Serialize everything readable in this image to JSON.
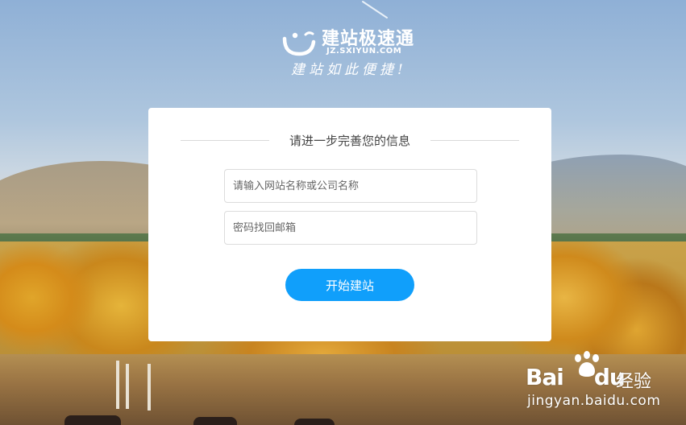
{
  "logo": {
    "name": "建站极速通",
    "domain": "JZ.SXIYUN.COM",
    "slogan": "建站如此便捷!"
  },
  "form": {
    "title": "请进一步完善您的信息",
    "site_name": {
      "placeholder": "请输入网站名称或公司名称",
      "value": ""
    },
    "email": {
      "placeholder": "密码找回邮箱",
      "value": ""
    },
    "submit_label": "开始建站"
  },
  "colors": {
    "accent": "#109ffb",
    "card_bg": "#ffffff",
    "divider": "#d9d9d9"
  },
  "watermark": {
    "brand": "Bai",
    "brand_suffix": "du",
    "label": "经验",
    "url": "jingyan.baidu.com"
  }
}
